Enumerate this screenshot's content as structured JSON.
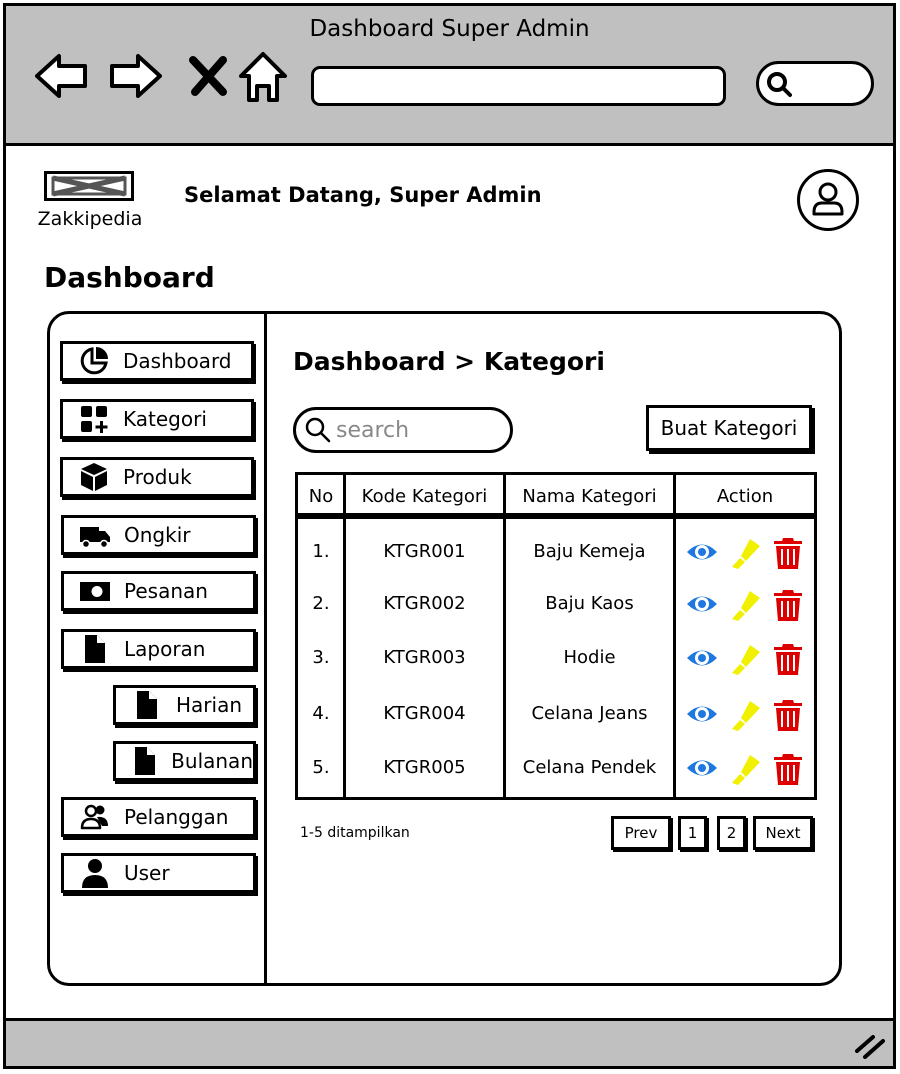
{
  "window": {
    "title": "Dashboard Super Admin"
  },
  "header": {
    "brand": "Zakkipedia",
    "welcome": "Selamat Datang, Super Admin"
  },
  "page": {
    "title": "Dashboard"
  },
  "sidebar": {
    "items": [
      {
        "label": "Dashboard",
        "icon": "pie-chart-icon"
      },
      {
        "label": "Kategori",
        "icon": "grid-add-icon"
      },
      {
        "label": "Produk",
        "icon": "box-icon"
      },
      {
        "label": "Ongkir",
        "icon": "truck-icon"
      },
      {
        "label": "Pesanan",
        "icon": "money-icon"
      },
      {
        "label": "Laporan",
        "icon": "file-icon"
      },
      {
        "label": "Harian",
        "icon": "file-icon"
      },
      {
        "label": "Bulanan",
        "icon": "file-icon"
      },
      {
        "label": "Pelanggan",
        "icon": "users-icon"
      },
      {
        "label": "User",
        "icon": "user-icon"
      }
    ]
  },
  "main": {
    "breadcrumb": "Dashboard > Kategori",
    "search": {
      "placeholder": "search",
      "value": ""
    },
    "create_label": "Buat Kategori",
    "table": {
      "headers": [
        "No",
        "Kode Kategori",
        "Nama Kategori",
        "Action"
      ],
      "rows": [
        {
          "no": "1.",
          "code": "KTGR001",
          "name": "Baju Kemeja"
        },
        {
          "no": "2.",
          "code": "KTGR002",
          "name": "Baju Kaos"
        },
        {
          "no": "3.",
          "code": "KTGR003",
          "name": "Hodie"
        },
        {
          "no": "4.",
          "code": "KTGR004",
          "name": "Celana Jeans"
        },
        {
          "no": "5.",
          "code": "KTGR005",
          "name": "Celana Pendek"
        }
      ],
      "row_actions": [
        "eye-icon",
        "highlighter-icon",
        "trash-icon"
      ]
    },
    "pagination": {
      "summary": "1-5 ditampilkan",
      "prev": "Prev",
      "pages": [
        "1",
        "2"
      ],
      "next": "Next"
    }
  },
  "colors": {
    "chrome": "#c0c0c0",
    "view": "#1e78e0",
    "edit": "#f0f000",
    "delete": "#dd0000"
  }
}
